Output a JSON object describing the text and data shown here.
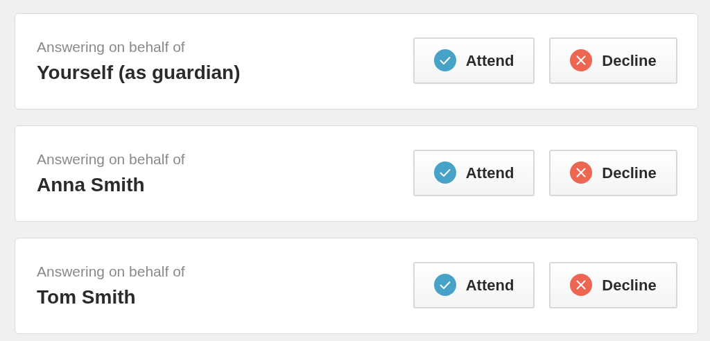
{
  "responses": [
    {
      "caption": "Answering on behalf of",
      "name": "Yourself (as guardian)",
      "buttons": [
        {
          "kind": "attend",
          "label": "Attend"
        },
        {
          "kind": "decline",
          "label": "Decline"
        }
      ]
    },
    {
      "caption": "Answering on behalf of",
      "name": "Anna Smith",
      "buttons": [
        {
          "kind": "attend",
          "label": "Attend"
        },
        {
          "kind": "decline",
          "label": "Decline"
        }
      ]
    },
    {
      "caption": "Answering on behalf of",
      "name": "Tom Smith",
      "buttons": [
        {
          "kind": "attend",
          "label": "Attend"
        },
        {
          "kind": "decline",
          "label": "Decline"
        }
      ]
    }
  ]
}
